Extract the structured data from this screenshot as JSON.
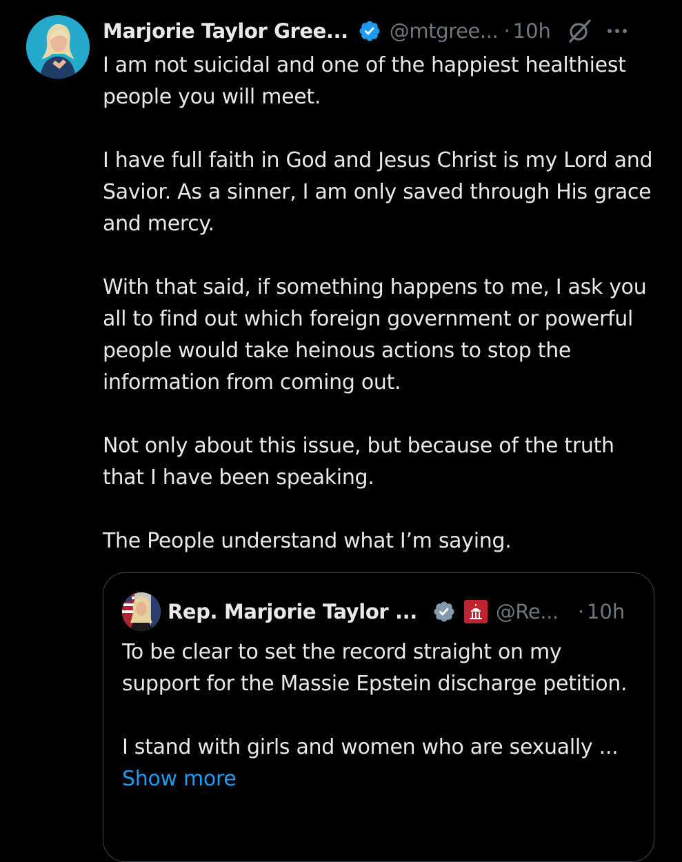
{
  "tweet": {
    "display_name": "Marjorie Taylor Gree...",
    "handle": "@mtgree...",
    "separator": "·",
    "time": "10h",
    "avatar_icon": "profile-photo",
    "verified_icon": "verified-badge-blue",
    "grok_icon": "grok-icon",
    "more_icon": "more-options-icon",
    "paragraphs": [
      "I am not suicidal and one of the happiest healthiest people you will meet.",
      "I have full faith in God and Jesus Christ is my Lord and Savior. As a sinner, I am only saved through His grace and mercy.",
      "With that said, if something happens to me, I ask you all to find out which foreign government or powerful people would take heinous actions to stop the information from coming out.",
      "Not only about this issue, but because of the truth that I have been speaking.",
      "The People understand what I’m saying."
    ]
  },
  "quoted": {
    "display_name": "Rep. Marjorie Taylor ...",
    "handle": "@Re...",
    "separator": "·",
    "time": "10h",
    "avatar_icon": "profile-photo",
    "verified_icon": "verified-badge-gray",
    "affiliation_icon": "us-capitol-affiliation-badge",
    "paragraphs": [
      "To be clear to set the record straight on my support for the Massie Epstein discharge petition.",
      "I stand with girls and women who are sexually ..."
    ],
    "show_more": "Show more"
  },
  "colors": {
    "background": "#000000",
    "text": "#e7e9ea",
    "secondary": "#71767b",
    "link": "#1d9bf0",
    "verified_blue": "#1d9bf0",
    "verified_gray": "#829aab",
    "border": "#3e4144"
  }
}
